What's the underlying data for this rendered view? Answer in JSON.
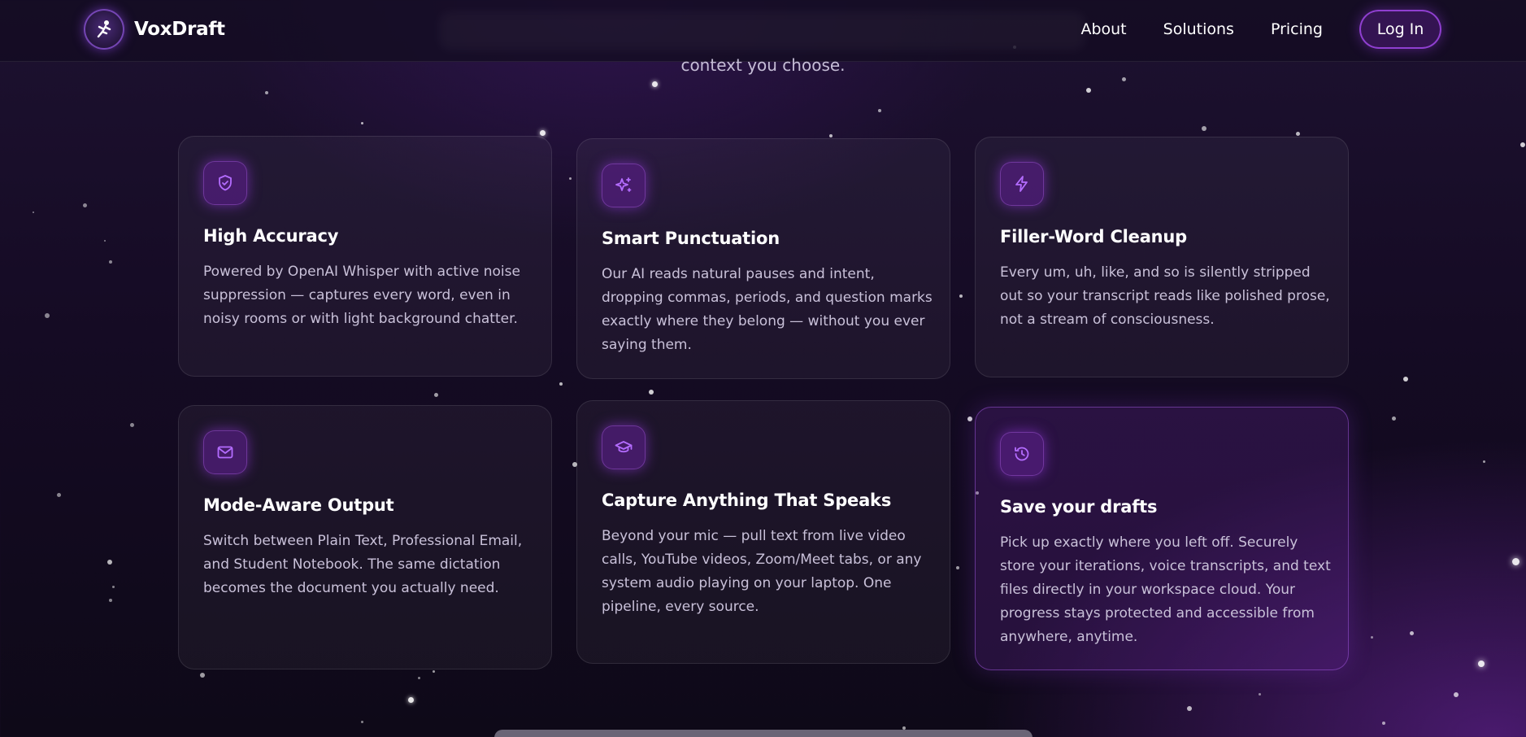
{
  "brand": {
    "name": "VoxDraft"
  },
  "nav": {
    "links": [
      "About",
      "Solutions",
      "Pricing"
    ],
    "login_label": "Log In"
  },
  "hero": {
    "subtitle_tail": "context you choose."
  },
  "features": [
    {
      "icon": "shield-check-icon",
      "title": "High Accuracy",
      "description": "Powered by OpenAI Whisper with active noise suppression — captures every word, even in noisy rooms or with light background chatter."
    },
    {
      "icon": "sparkles-icon",
      "title": "Smart Punctuation",
      "description": "Our AI reads natural pauses and intent, dropping commas, periods, and question marks exactly where they belong — without you ever saying them."
    },
    {
      "icon": "lightning-icon",
      "title": "Filler-Word Cleanup",
      "description": "Every um, uh, like, and so is silently stripped out so your transcript reads like polished prose, not a stream of consciousness."
    },
    {
      "icon": "mail-icon",
      "title": "Mode-Aware Output",
      "description": "Switch between Plain Text, Professional Email, and Student Notebook. The same dictation becomes the document you actually need."
    },
    {
      "icon": "graduation-cap-icon",
      "title": "Capture Anything That Speaks",
      "description": "Beyond your mic — pull text from live video calls, YouTube videos, Zoom/Meet tabs, or any system audio playing on your laptop. One pipeline, every source."
    },
    {
      "icon": "history-icon",
      "title": "Save your drafts",
      "description": "Pick up exactly where you left off. Securely store your iterations, voice transcripts, and text files directly in your workspace cloud. Your progress stays protected and accessible from anywhere, anytime."
    }
  ],
  "colors": {
    "accent": "#a855f7",
    "background": "#150b24",
    "card_text": "#c9c1d9"
  }
}
